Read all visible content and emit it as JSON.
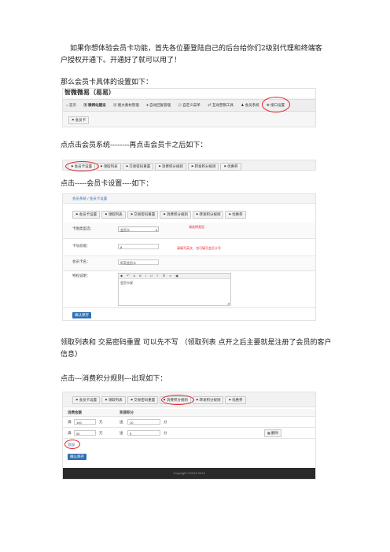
{
  "paragraphs": {
    "p1": "如果你想体验会员卡功能，首先各位要登陆自己的后台给你们2级别代理和终端客户授权开通下。开通好了就可以用了！",
    "p2": "那么会员卡具体的设置如下：",
    "p3": "点点击会员系统--------再点击会员卡之后如下：",
    "p4": "点击-----会员卡设置----如下：",
    "p5": "领取列表和 交易密码重置 可以先不写 （领取列表 点开之后主要就是注册了会员的客户信息）",
    "p6": "点击---消费积分规则---出现如下："
  },
  "shot1": {
    "logo_text": "智微微易（易易）",
    "nav": [
      "首页",
      "微网站建设",
      "图文素材管理",
      "自动回复管理",
      "自定义菜单",
      "互动营销工具",
      "会员系统",
      "接口设置"
    ],
    "sub": "会员卡"
  },
  "shot2": {
    "tabs": [
      "会员卡设置",
      "领取列表",
      "交易密码重置",
      "消费积分规则",
      "转发积分规则",
      "优惠券"
    ]
  },
  "shot3": {
    "breadcrumb": "会员系统 / 会员卡设置",
    "tabs": [
      "会员卡设置",
      "领取列表",
      "交易密码重置",
      "消费积分规则",
      "转发积分规则",
      "优惠券"
    ],
    "fields": {
      "type_label": "卡图类型选：",
      "type_value": "会员卡",
      "type_note": "请选择类型",
      "num_label": "卡号前缀：",
      "num_value": "8",
      "num_note": "请填写英文，也可填写会员卡号",
      "name_label": "会员卡名：",
      "name_value": "阿芳会员卡",
      "desc_label": "特权说明：",
      "desc_value": "会员卡说"
    },
    "submit": "确认保存"
  },
  "shot4": {
    "tabs": [
      "会员卡设置",
      "领取列表",
      "交易密码重置",
      "消费积分规则",
      "转发积分规则",
      "优惠券"
    ],
    "col1": "消费金额",
    "col2": "奖得积分",
    "rows": [
      {
        "prefix": "满",
        "amount": "100",
        "unit": "元",
        "mid": "送",
        "points": "10",
        "unit2": "分"
      },
      {
        "prefix": "满",
        "amount": "50",
        "unit": "元",
        "mid": "送",
        "points": "5",
        "unit2": "分"
      }
    ],
    "delete": "删除",
    "add": "添加",
    "submit": "确认保存",
    "footer": "Copyright ©2013-2013"
  }
}
